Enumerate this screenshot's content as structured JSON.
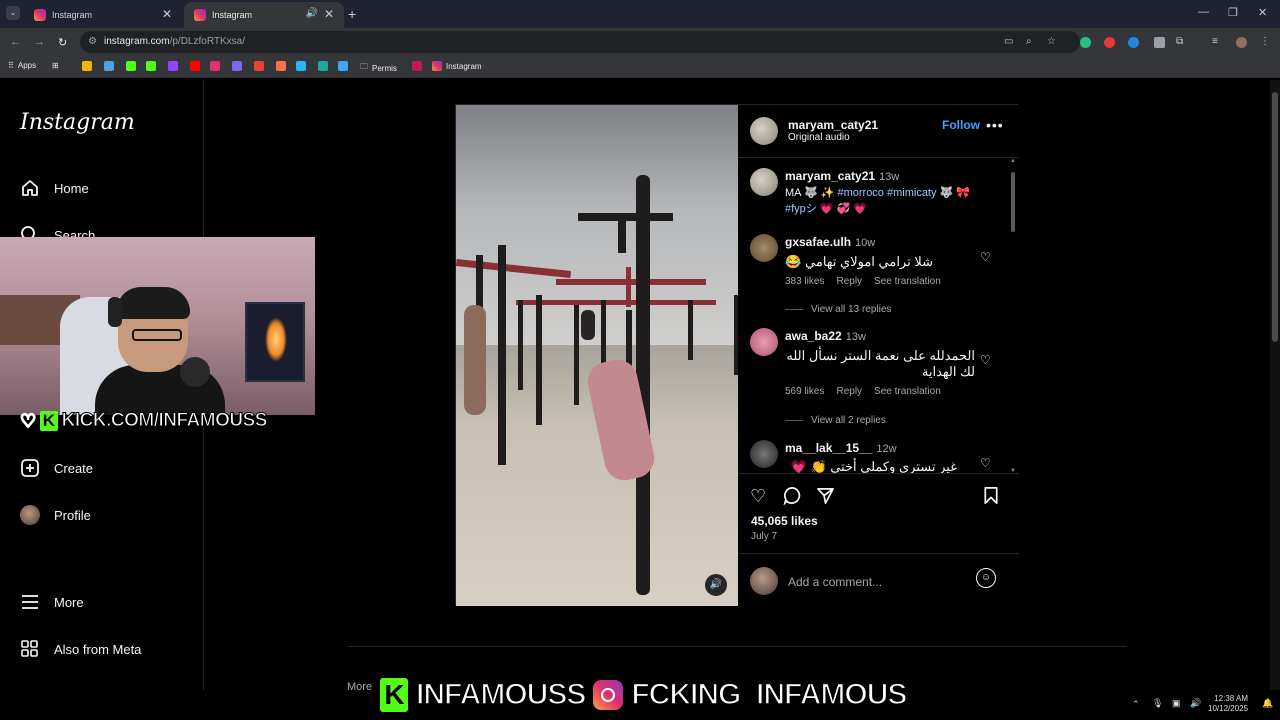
{
  "browser": {
    "tabs": [
      {
        "title": "Instagram"
      },
      {
        "title": "Instagram"
      }
    ],
    "url_host": "instagram.com",
    "url_path": "/p/DLzfoRTKxsa/",
    "bookmarks": {
      "apps": "Apps",
      "permis": "Permis",
      "instagram": "Instagram"
    }
  },
  "sidebar": {
    "logo": "Instagram",
    "items": [
      {
        "label": "Home"
      },
      {
        "label": "Search"
      },
      {
        "label": "Create"
      },
      {
        "label": "Profile"
      },
      {
        "label": "More"
      },
      {
        "label": "Also from Meta"
      }
    ]
  },
  "overlay": {
    "kick_url": "KICK.COM/INFAMOUSS",
    "kick_badge": "K",
    "banner_kick": "INFAMOUSS",
    "banner_ig": "FCKING_INFAMOUS"
  },
  "post": {
    "header_user": "maryam_caty21",
    "header_sub": "Original audio",
    "follow": "Follow",
    "caption": {
      "user": "maryam_caty21",
      "time": "13w",
      "line1": "MA 🐺 ✨",
      "tags1": "#morroco #mimicaty",
      "line1_end": "🐺 🎀",
      "tags2": "#fypシ",
      "line2_end": "💗 💞 💗"
    },
    "comments": [
      {
        "user": "gxsafae.ulh",
        "time": "10w",
        "text": "شلا ترامي امولاي تهامي 😂",
        "likes": "383 likes",
        "reply": "Reply",
        "translate": "See translation",
        "view_replies": "View all 13 replies"
      },
      {
        "user": "awa_ba22",
        "time": "13w",
        "text": "الحمدلله على نعمة الستر نسأل الله لك الهداية",
        "likes": "569 likes",
        "reply": "Reply",
        "translate": "See translation",
        "view_replies": "View all 2 replies"
      },
      {
        "user": "ma__lak__15__",
        "time": "12w",
        "text": "غير تستري وكملي أختي 👏 💗"
      }
    ],
    "likes": "45,065 likes",
    "date": "July 7",
    "add_comment_placeholder": "Add a comment...",
    "more_posts_label": "More"
  },
  "tray": {
    "time": "12:38 AM",
    "date": "10/12/2025"
  },
  "colors": {
    "accent": "#4a9df8",
    "kick_green": "#53fc18",
    "background": "#000000"
  }
}
